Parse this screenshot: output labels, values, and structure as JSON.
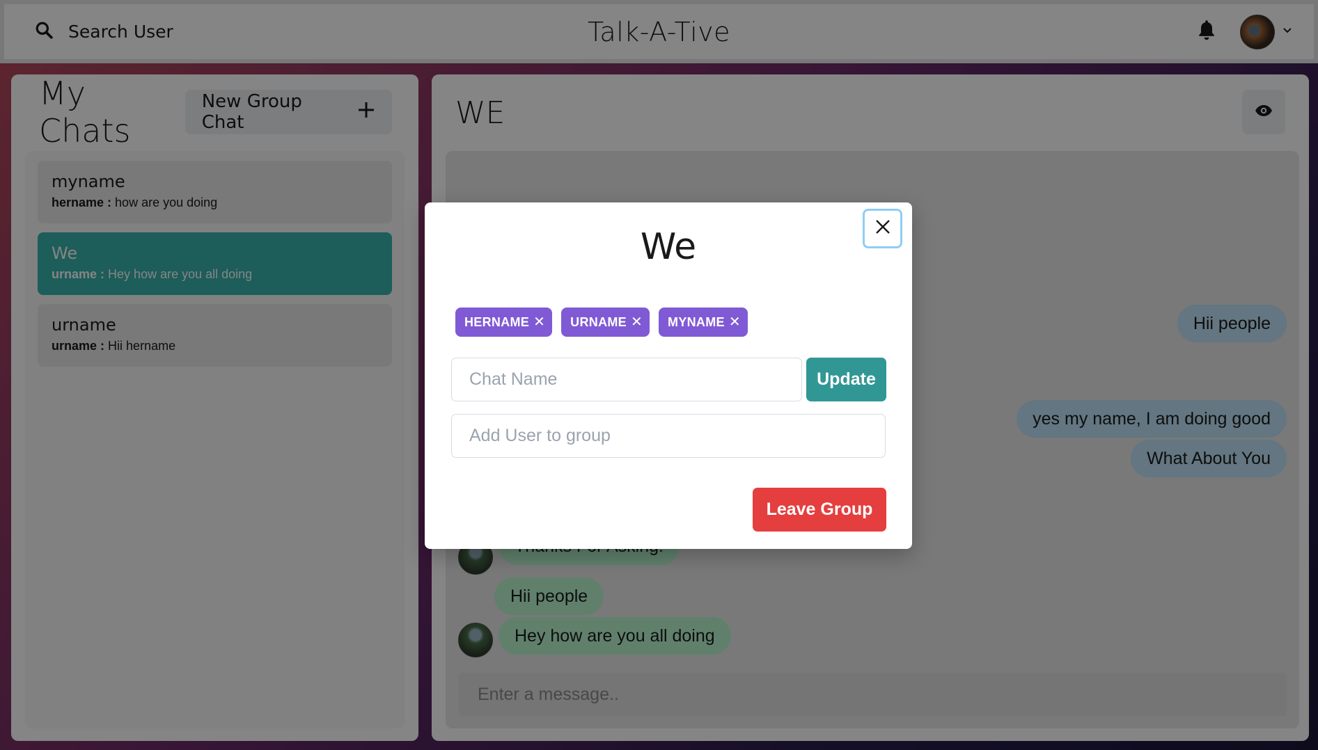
{
  "header": {
    "search_label": "Search User",
    "app_title": "Talk-A-Tive"
  },
  "chats_panel": {
    "title": "My Chats",
    "new_group_label": "New Group Chat",
    "items": [
      {
        "name": "myname",
        "sender": "hername :",
        "text": "how are you doing",
        "active": false
      },
      {
        "name": "We",
        "sender": "urname :",
        "text": "Hey how are you all doing",
        "active": true
      },
      {
        "name": "urname",
        "sender": "urname :",
        "text": "Hii hername",
        "active": false
      }
    ]
  },
  "chat_panel": {
    "title": "WE",
    "messages": [
      {
        "text": "Hii people",
        "side": "sent"
      },
      {
        "text": "yes my name, I am doing good",
        "side": "sent"
      },
      {
        "text": "What About You",
        "side": "sent"
      },
      {
        "text": "Thanks For Asking!",
        "side": "received"
      },
      {
        "text": "Hii people",
        "side": "received"
      },
      {
        "text": "Hey how are you all doing",
        "side": "received"
      }
    ],
    "input_placeholder": "Enter a message.."
  },
  "modal": {
    "title": "We",
    "members": [
      "HERNAME",
      "URNAME",
      "MYNAME"
    ],
    "chat_name_placeholder": "Chat Name",
    "update_label": "Update",
    "add_user_placeholder": "Add User to group",
    "leave_label": "Leave Group"
  },
  "colors": {
    "accent_teal": "#38b2ac",
    "badge_purple": "#805ad5",
    "danger_red": "#e53e3e",
    "sent_bubble": "#bee3f8",
    "received_bubble": "#b9f5d0"
  },
  "icons": {
    "search": "search-icon",
    "notifications": "bell-icon",
    "avatar_menu": "chevron-down-icon",
    "new_group": "plus-icon",
    "view_profile": "eye-icon",
    "close": "close-icon"
  }
}
